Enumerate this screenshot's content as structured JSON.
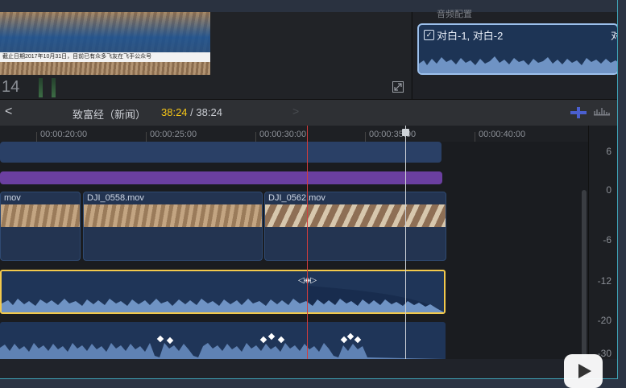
{
  "viewer": {
    "caption": "截止日期2017年10月31日，目前已有众多飞友在飞手公众号",
    "timecode": "14"
  },
  "inspector": {
    "title": "音频配置",
    "role_label": "对白-1, 对白-2",
    "role_label_overflow": "对",
    "checked": "✓"
  },
  "header": {
    "back": "<",
    "project_name": "致富经（新闻）",
    "current_duration": "38:24",
    "separator": " / ",
    "total_duration": "38:24",
    "forward": ">"
  },
  "ruler": {
    "labels": [
      "00:00:20:00",
      "00:00:25:00",
      "00:00:30:00",
      "00:00:35:00",
      "00:00:40:00"
    ]
  },
  "clips": {
    "video": [
      {
        "name": "mov"
      },
      {
        "name": "DJI_0558.mov"
      },
      {
        "name": "DJI_0562.mov"
      }
    ]
  },
  "meter": {
    "labels": [
      "6",
      "0",
      "-6",
      "-12",
      "-20",
      "-30"
    ]
  },
  "colors": {
    "playhead": "#d33c3c",
    "selection": "#f2c94c",
    "current_duration": "#f5c518",
    "role_accent": "#9cc0ec"
  },
  "icons": {
    "fullscreen": "fullscreen-icon",
    "skimming": "skimming-icon",
    "audio_snap": "audio-snap-icon",
    "play": "play-icon"
  }
}
